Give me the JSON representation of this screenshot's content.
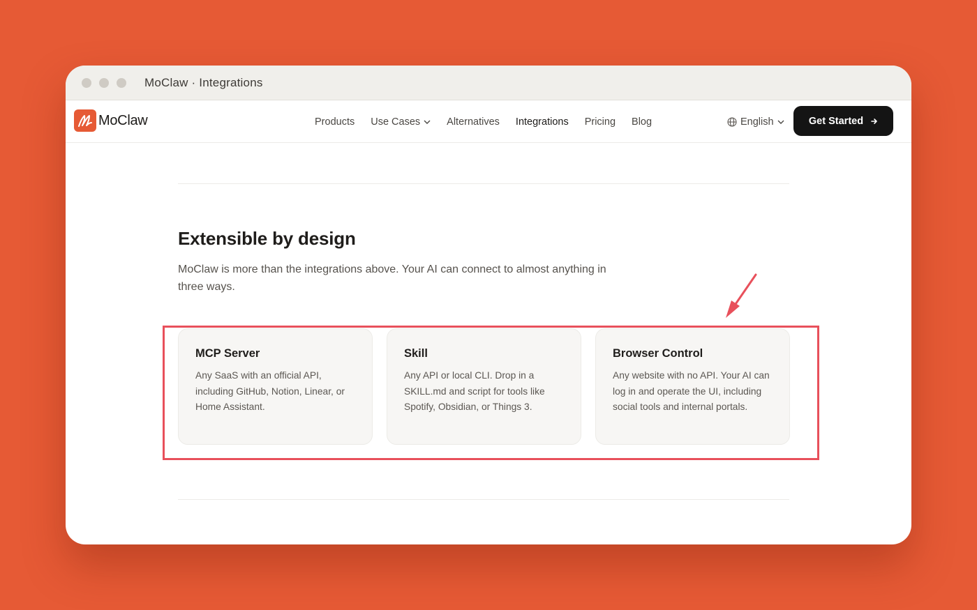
{
  "window": {
    "title": "MoClaw · Integrations"
  },
  "brand": {
    "name": "MoClaw",
    "accent_color": "#E65A35"
  },
  "nav": {
    "links": [
      {
        "label": "Products"
      },
      {
        "label": "Use Cases",
        "has_dropdown": true
      },
      {
        "label": "Alternatives"
      },
      {
        "label": "Integrations",
        "active": true
      },
      {
        "label": "Pricing"
      },
      {
        "label": "Blog"
      }
    ],
    "language": "English",
    "cta_label": "Get Started"
  },
  "section": {
    "title": "Extensible by design",
    "description": "MoClaw is more than the integrations above. Your AI can connect to almost anything in three ways.",
    "cards": [
      {
        "title": "MCP Server",
        "body": "Any SaaS with an official API, including GitHub, Notion, Linear, or Home Assistant."
      },
      {
        "title": "Skill",
        "body": "Any API or local CLI. Drop in a SKILL.md and script for tools like Spotify, Obsidian, or Things 3."
      },
      {
        "title": "Browser Control",
        "body": "Any website with no API. Your AI can log in and operate the UI, including social tools and internal portals."
      }
    ]
  },
  "annotation": {
    "highlight_color": "#E8505B",
    "icon": "arrow-pointer-icon"
  }
}
